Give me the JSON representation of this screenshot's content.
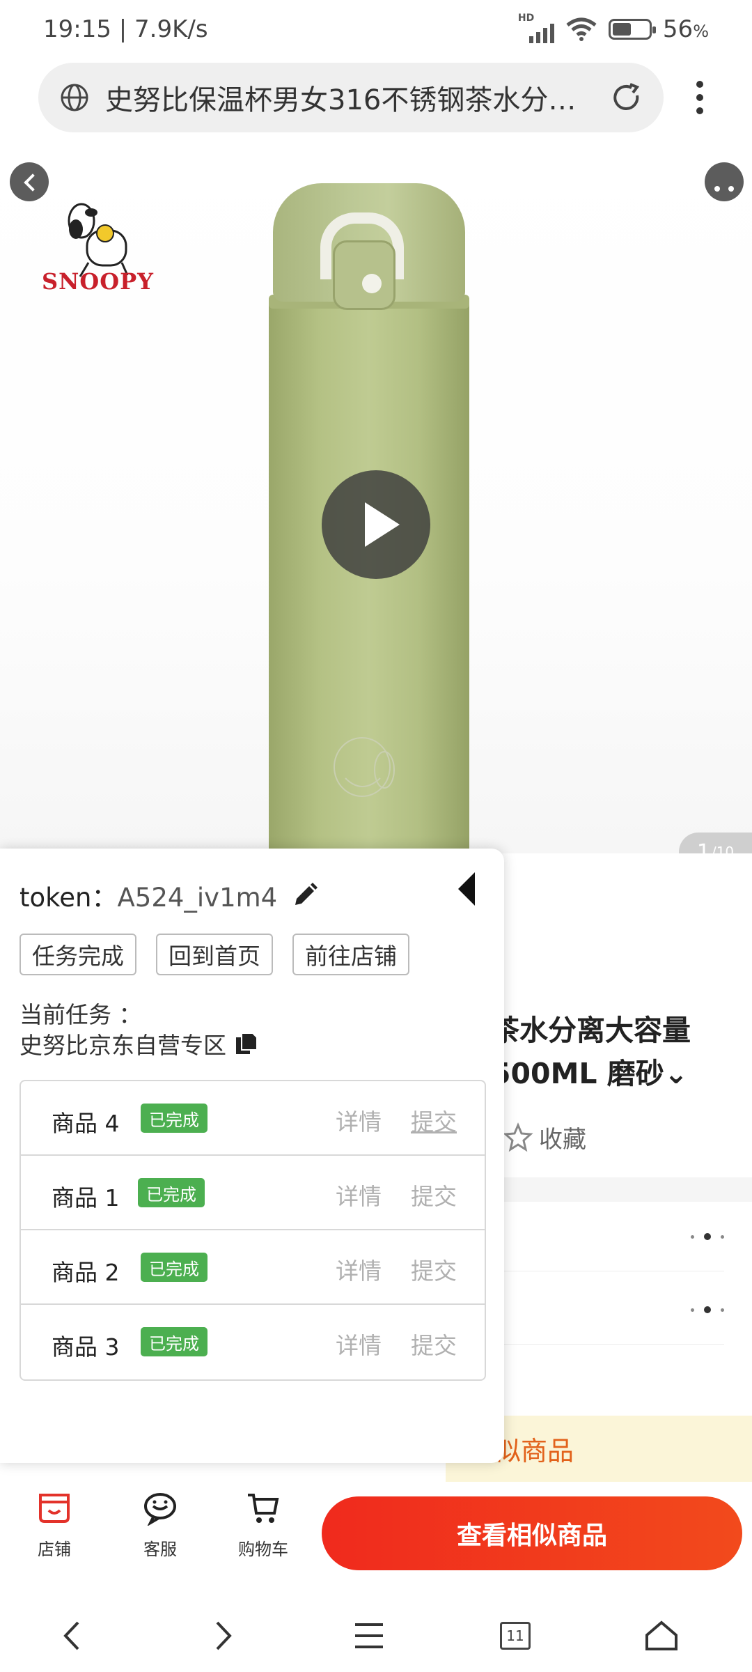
{
  "status": {
    "time_speed": "19:15 | 7.9K/s",
    "network_label": "HD",
    "battery_percent": "56",
    "battery_unit": "%"
  },
  "address_bar": {
    "url_text": "史努比保温杯男女316不锈钢茶水分离..."
  },
  "hero": {
    "brand_name": "SNOOPY",
    "pager_current": "1",
    "pager_total": "/10"
  },
  "product": {
    "title_line1": "茶水分离大容量",
    "title_line2": "500ML 磨砂⌄",
    "favorite_label": "收藏",
    "similar_banner": "似商品"
  },
  "panel": {
    "token_label": "token：",
    "token_value": "A524_iv1m4",
    "buttons": [
      "任务完成",
      "回到首页",
      "前往店铺"
    ],
    "current_task_label": "当前任务 ：",
    "current_task_name": "史努比京东自营专区",
    "rows": [
      {
        "name": "商品 4",
        "status": "已完成",
        "detail": "详情",
        "submit": "提交"
      },
      {
        "name": "商品 1",
        "status": "已完成",
        "detail": "详情",
        "submit": "提交"
      },
      {
        "name": "商品 2",
        "status": "已完成",
        "detail": "详情",
        "submit": "提交"
      },
      {
        "name": "商品 3",
        "status": "已完成",
        "detail": "详情",
        "submit": "提交"
      }
    ]
  },
  "actionbar": {
    "store_label": "店铺",
    "service_label": "客服",
    "cart_label": "购物车",
    "cta_label": "查看相似商品"
  },
  "sysnav": {
    "tabs_count": "11"
  },
  "colors": {
    "accent_red": "#f02a1d",
    "badge_green": "#4caf50",
    "bottle_green": "#b4c184",
    "brand_red": "#c8202b"
  }
}
